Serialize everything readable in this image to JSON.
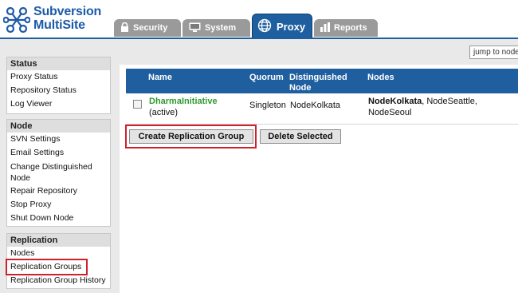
{
  "app": {
    "logo_line1": "Subversion",
    "logo_line2": "MultiSite",
    "brand_color": "#1f5fa0"
  },
  "tabs": [
    {
      "label": "Security",
      "icon": "lock-icon"
    },
    {
      "label": "System",
      "icon": "monitor-icon"
    },
    {
      "label": "Proxy",
      "icon": "globe-icon",
      "active": true
    },
    {
      "label": "Reports",
      "icon": "bar-chart-icon"
    }
  ],
  "jump": {
    "placeholder": "jump to node"
  },
  "sidebar": {
    "status": {
      "title": "Status",
      "items": [
        "Proxy Status",
        "Repository Status",
        "Log Viewer"
      ]
    },
    "node": {
      "title": "Node",
      "items": [
        "SVN Settings",
        "Email Settings",
        "Change Distinguished Node",
        "Repair Repository",
        "Stop Proxy",
        "Shut Down Node"
      ]
    },
    "replication": {
      "title": "Replication",
      "items": [
        "Nodes",
        "Replication Groups",
        "Replication Group History"
      ]
    }
  },
  "table": {
    "headers": {
      "name": "Name",
      "quorum": "Quorum",
      "dn1": "Distinguished",
      "dn2": "Node",
      "nodes": "Nodes"
    },
    "rows": [
      {
        "name": "DharmaInitiative",
        "status": "(active)",
        "quorum": "Singleton",
        "distinguished": "NodeKolkata",
        "nodes_bold": "NodeKolkata",
        "nodes_rest1": ", NodeSeattle,",
        "nodes_rest2": "NodeSeoul"
      }
    ]
  },
  "buttons": {
    "create": "Create Replication Group",
    "delete": "Delete Selected"
  },
  "highlight_color": "#d0202a"
}
